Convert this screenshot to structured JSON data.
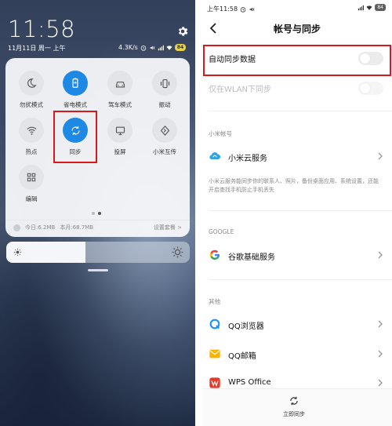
{
  "shade": {
    "clock": "11:58",
    "date": "11月11日 周一 上午",
    "net_speed": "4.3K/s",
    "battery": "84",
    "toggles": [
      {
        "label": "勿扰模式",
        "on": false,
        "icon": "moon-icon"
      },
      {
        "label": "省电模式",
        "on": true,
        "icon": "battery-saver-icon"
      },
      {
        "label": "驾车模式",
        "on": false,
        "icon": "car-icon"
      },
      {
        "label": "振动",
        "on": false,
        "icon": "vibrate-icon"
      },
      {
        "label": "热点",
        "on": false,
        "icon": "hotspot-icon"
      },
      {
        "label": "同步",
        "on": true,
        "icon": "sync-icon"
      },
      {
        "label": "投屏",
        "on": false,
        "icon": "cast-screen-icon"
      },
      {
        "label": "小米互传",
        "on": false,
        "icon": "transfer-icon"
      },
      {
        "label": "编辑",
        "on": false,
        "icon": "grid-icon"
      }
    ],
    "page_dots": {
      "total": 2,
      "active": 2
    },
    "storage_today": "今日:6.2MB",
    "storage_month": "本月:68.7MB",
    "plan_link": "设置套餐 >",
    "brightness": 0.43,
    "accent": "#1e88e5",
    "highlight": "#d7191c"
  },
  "settings": {
    "status_time": "上午11:58",
    "battery": "84",
    "title": "帐号与同步",
    "auto_sync": {
      "label": "自动同步数据",
      "on": false
    },
    "wlan_only": {
      "label": "仅在WLAN下同步",
      "on": false
    },
    "section_xiaomi": "小米帐号",
    "mi_cloud": {
      "label": "小米云服务",
      "icon": "mi-cloud-icon"
    },
    "mi_cloud_desc": "小米云服务能同步你的联系人、照片，备份桌面应用、系统设置，还能开启查找手机防止手机丢失",
    "section_google": "GOOGLE",
    "google": {
      "label": "谷歌基础服务",
      "icon": "google-icon"
    },
    "section_other": "其他",
    "other_items": [
      {
        "label": "QQ浏览器",
        "icon": "qq-browser-icon"
      },
      {
        "label": "QQ邮箱",
        "icon": "qq-mail-icon"
      },
      {
        "label": "WPS Office",
        "icon": "wps-office-icon"
      }
    ],
    "sync_now": "立即同步"
  }
}
